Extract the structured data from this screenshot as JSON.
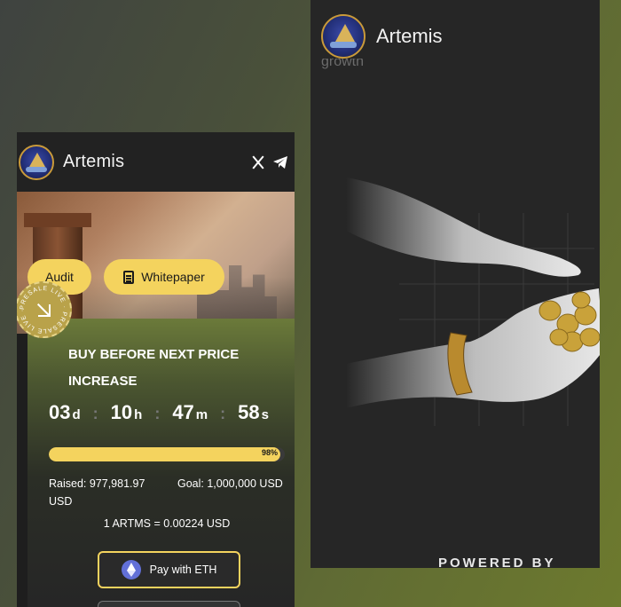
{
  "left_panel": {
    "brand": "Artemis",
    "header_icons": [
      "x-icon",
      "telegram-icon"
    ],
    "buttons": {
      "audit": "Audit",
      "whitepaper": "Whitepaper"
    },
    "badge": {
      "text": "PRESALE LIVE · PRESALE LIVE ·"
    },
    "headline": "BUY BEFORE NEXT PRICE INCREASE",
    "countdown": {
      "days": "03",
      "days_unit": "d",
      "hours": "10",
      "hours_unit": "h",
      "minutes": "47",
      "minutes_unit": "m",
      "seconds": "58",
      "seconds_unit": "s"
    },
    "progress": {
      "value": 0.98,
      "label": "98%"
    },
    "raised": "Raised: 977,981.97 USD",
    "goal": "Goal: 1,000,000 USD",
    "price": "1 ARTMS = 0.00224 USD",
    "pay_button": "Pay with ETH",
    "colors": {
      "accent": "#f4d35e",
      "panel": "#1e1e1e"
    }
  },
  "right_panel": {
    "brand": "Artemis",
    "growth_partial": "growth",
    "powered_by": "POWERED BY"
  }
}
